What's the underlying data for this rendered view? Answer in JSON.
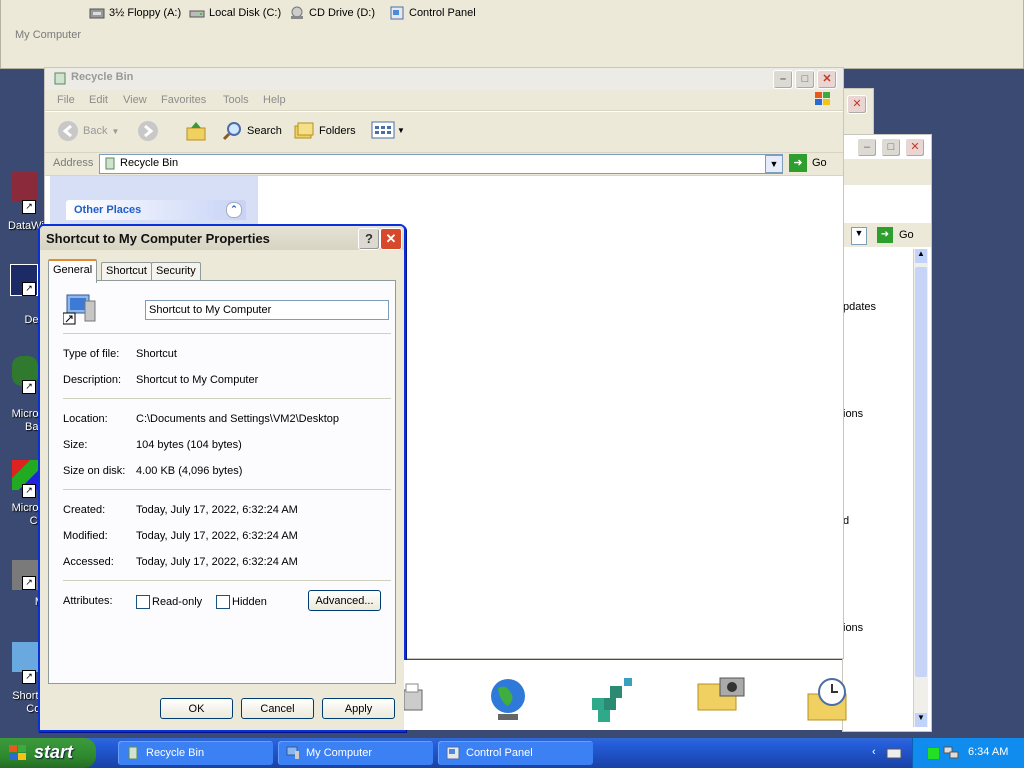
{
  "topbar": {
    "title": "My Computer",
    "drives": [
      {
        "label": "3½ Floppy (A:)",
        "icon": "floppy-drive-icon"
      },
      {
        "label": "Local Disk (C:)",
        "icon": "hard-disk-icon"
      },
      {
        "label": "CD Drive (D:)",
        "icon": "cd-drive-icon"
      },
      {
        "label": "Control Panel",
        "icon": "control-panel-icon"
      }
    ]
  },
  "desktop": {
    "icons": [
      {
        "label": "DataWi"
      },
      {
        "label": "Dev"
      },
      {
        "label": "Micros",
        "label2": "Bas"
      },
      {
        "label": "Micros",
        "label2": "C+"
      },
      {
        "label": "M"
      },
      {
        "label": "Shortc",
        "label2": "Cor"
      }
    ]
  },
  "recycle_bin_window": {
    "title": "Recycle Bin",
    "menu": [
      "File",
      "Edit",
      "View",
      "Favorites",
      "Tools",
      "Help"
    ],
    "toolbar": {
      "back": "Back",
      "search": "Search",
      "folders": "Folders"
    },
    "address_label": "Address",
    "address_value": "Recycle Bin",
    "go": "Go",
    "side_panel_heading": "Other Places"
  },
  "back_window": {
    "go": "Go",
    "items": [
      "pdates",
      "ions",
      "d",
      "ions"
    ]
  },
  "dialog": {
    "title": "Shortcut to My Computer Properties",
    "tabs": [
      "General",
      "Shortcut",
      "Security"
    ],
    "name_value": "Shortcut to My Computer",
    "fields": {
      "type_label": "Type of file:",
      "type_value": "Shortcut",
      "desc_label": "Description:",
      "desc_value": "Shortcut to My Computer",
      "location_label": "Location:",
      "location_value": "C:\\Documents and Settings\\VM2\\Desktop",
      "size_label": "Size:",
      "size_value": "104 bytes (104 bytes)",
      "size_on_disk_label": "Size on disk:",
      "size_on_disk_value": "4.00 KB (4,096 bytes)",
      "created_label": "Created:",
      "created_value": "Today, July 17, 2022, 6:32:24 AM",
      "modified_label": "Modified:",
      "modified_value": "Today, July 17, 2022, 6:32:24 AM",
      "accessed_label": "Accessed:",
      "accessed_value": "Today, July 17, 2022, 6:32:24 AM",
      "attributes_label": "Attributes:"
    },
    "attributes": {
      "readonly": "Read-only",
      "hidden": "Hidden",
      "advanced": "Advanced..."
    },
    "buttons": {
      "ok": "OK",
      "cancel": "Cancel",
      "apply": "Apply"
    }
  },
  "taskbar": {
    "start": "start",
    "tasks": [
      {
        "label": "Recycle Bin"
      },
      {
        "label": "My Computer"
      },
      {
        "label": "Control Panel"
      }
    ],
    "clock": "6:34 AM"
  },
  "colors": {
    "title_active": "#0831d9",
    "taskbar": "#245edb",
    "start": "#2f8a2f",
    "desktop": "#3a4a73"
  }
}
